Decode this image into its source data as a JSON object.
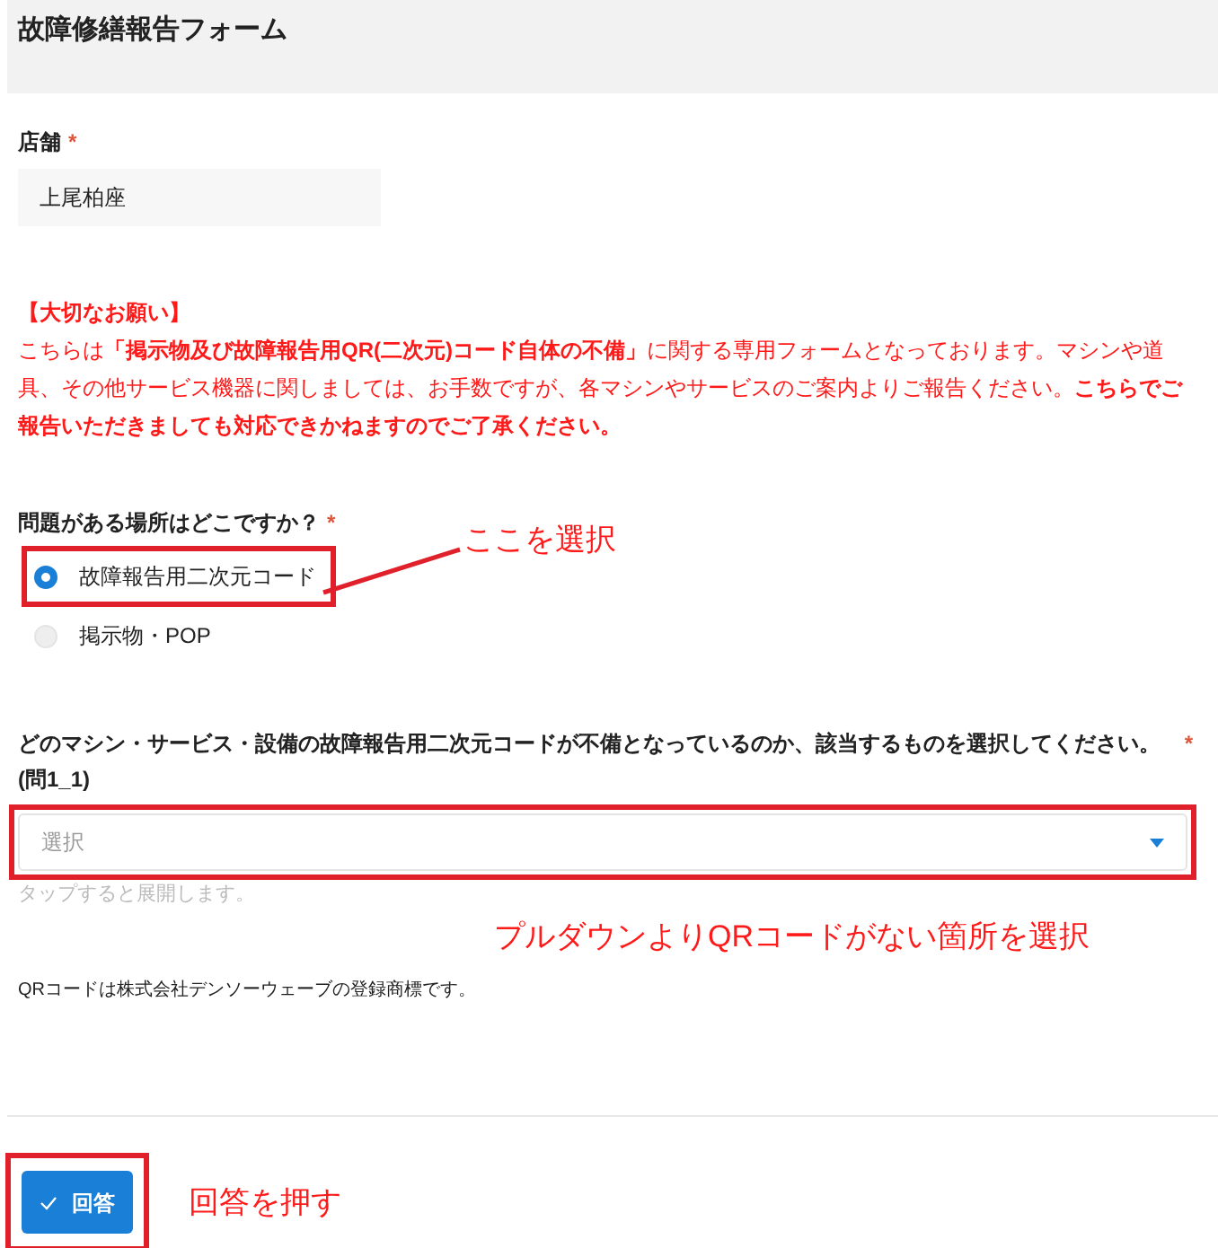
{
  "header": {
    "title": "故障修繕報告フォーム"
  },
  "store": {
    "label": "店舗",
    "required_mark": "*",
    "value": "上尾柏座"
  },
  "notice": {
    "title": "【大切なお願い】",
    "body": "こちらは**「掲示物及び故障報告用QR(二次元)コード自体の不備」**に関する専用フォームとなっております。マシンや道具、その他サービス機器に関しましては、お手数ですが、各マシンやサービスのご案内よりご報告ください。**こちらでご報告いただきましても対応できかねますのでご了承ください。**"
  },
  "question1": {
    "label": "問題がある場所はどこですか？",
    "required_mark": "*",
    "options": [
      {
        "label": "故障報告用二次元コード",
        "selected": true
      },
      {
        "label": "掲示物・POP",
        "selected": false
      }
    ]
  },
  "question2": {
    "label": "どのマシン・サービス・設備の故障報告用二次元コードが不備となっているのか、該当するものを選択してください。(問1_1)",
    "required_mark": "*",
    "placeholder": "選択",
    "hint": "タップすると展開します。"
  },
  "footnote": "QRコードは株式会社デンソーウェーブの登録商標です。",
  "submit": {
    "label": "回答"
  },
  "annotations": [
    {
      "text": "ここを選択"
    },
    {
      "text": "プルダウンよりQRコードがない箇所を選択"
    },
    {
      "text": "回答を押す"
    }
  ]
}
